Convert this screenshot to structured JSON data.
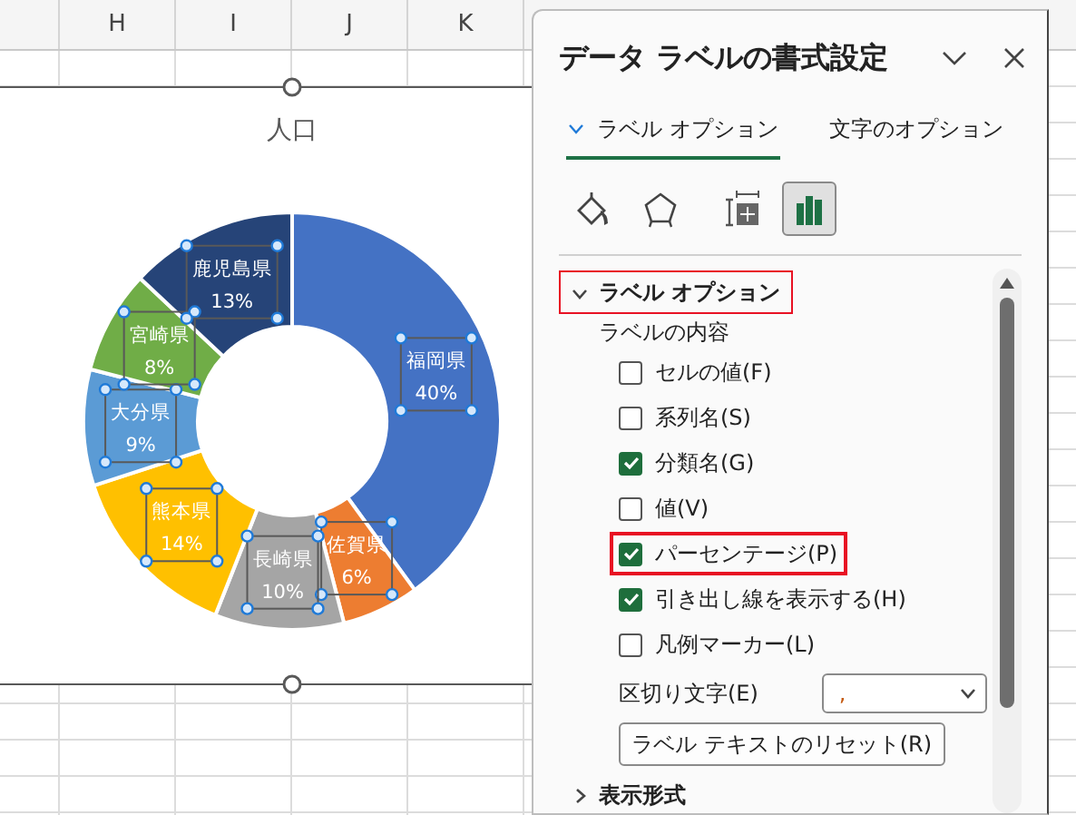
{
  "sheet": {
    "columns": [
      "H",
      "I",
      "J",
      "K"
    ]
  },
  "chart": {
    "title": "人口",
    "labels_selected": true,
    "chart_data": {
      "type": "donut",
      "categories": [
        "福岡県",
        "佐賀県",
        "長崎県",
        "熊本県",
        "大分県",
        "宮崎県",
        "鹿児島県"
      ],
      "values": [
        40,
        6,
        10,
        14,
        9,
        8,
        13
      ],
      "value_labels": [
        "40%",
        "6%",
        "10%",
        "14%",
        "9%",
        "8%",
        "13%"
      ]
    }
  },
  "panel": {
    "title": "データ ラベルの書式設定",
    "tabs": [
      {
        "label": "ラベル オプション",
        "selected": true
      },
      {
        "label": "文字のオプション",
        "selected": false
      }
    ],
    "icon_tabs": [
      {
        "kind": "fill",
        "selected": false
      },
      {
        "kind": "effects",
        "selected": false
      },
      {
        "kind": "size",
        "selected": false
      },
      {
        "kind": "options",
        "selected": true
      }
    ],
    "sections": [
      {
        "title": "ラベル オプション",
        "expanded": true,
        "highlighted": true,
        "subheading": "ラベルの内容",
        "options": [
          {
            "label": "セルの値(F)",
            "checked": false,
            "highlighted": false
          },
          {
            "label": "系列名(S)",
            "checked": false,
            "highlighted": false
          },
          {
            "label": "分類名(G)",
            "checked": true,
            "highlighted": false
          },
          {
            "label": "値(V)",
            "checked": false,
            "highlighted": false
          },
          {
            "label": "パーセンテージ(P)",
            "checked": true,
            "highlighted": true
          },
          {
            "label": "引き出し線を表示する(H)",
            "checked": true,
            "highlighted": false
          },
          {
            "label": "凡例マーカー(L)",
            "checked": false,
            "highlighted": false
          }
        ],
        "separator": {
          "label": "区切り文字(E)",
          "value": ","
        },
        "reset_button": "ラベル テキストのリセット(R)"
      },
      {
        "title": "表示形式",
        "expanded": false,
        "highlighted": false
      }
    ]
  }
}
